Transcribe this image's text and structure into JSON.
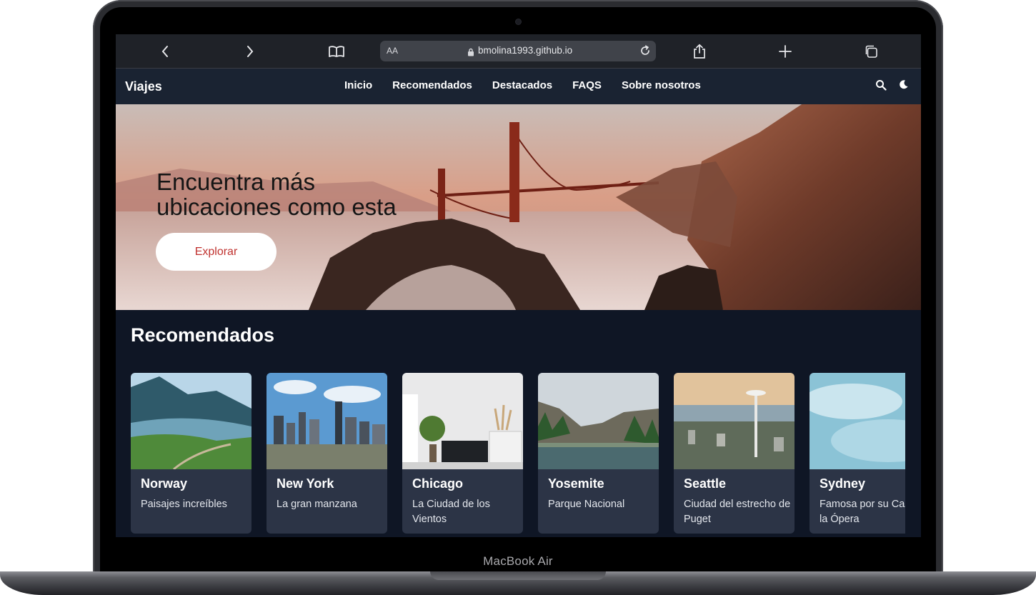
{
  "device": {
    "model_label": "MacBook Air"
  },
  "browser": {
    "address_prefix": "AA",
    "url": "bmolina1993.github.io"
  },
  "site": {
    "brand": "Viajes",
    "nav": [
      "Inicio",
      "Recomendados",
      "Destacados",
      "FAQS",
      "Sobre nosotros"
    ]
  },
  "hero": {
    "title_line1": "Encuentra más",
    "title_line2": "ubicaciones como esta",
    "cta": "Explorar"
  },
  "recommended": {
    "title": "Recomendados",
    "cards": [
      {
        "name": "Norway",
        "description": "Paisajes increíbles"
      },
      {
        "name": "New York",
        "description": "La gran manzana"
      },
      {
        "name": "Chicago",
        "description": "La Ciudad de los Vientos"
      },
      {
        "name": "Yosemite",
        "description": "Parque Nacional"
      },
      {
        "name": "Seattle",
        "description": "Ciudad del estrecho de Puget"
      },
      {
        "name": "Sydney",
        "description": "Famosa por su Casa de la Ópera"
      }
    ]
  },
  "colors": {
    "page_bg": "#0f1625",
    "header_bg": "#1a2332",
    "card_bg": "#2c3446",
    "cta_text": "#c0322f"
  }
}
